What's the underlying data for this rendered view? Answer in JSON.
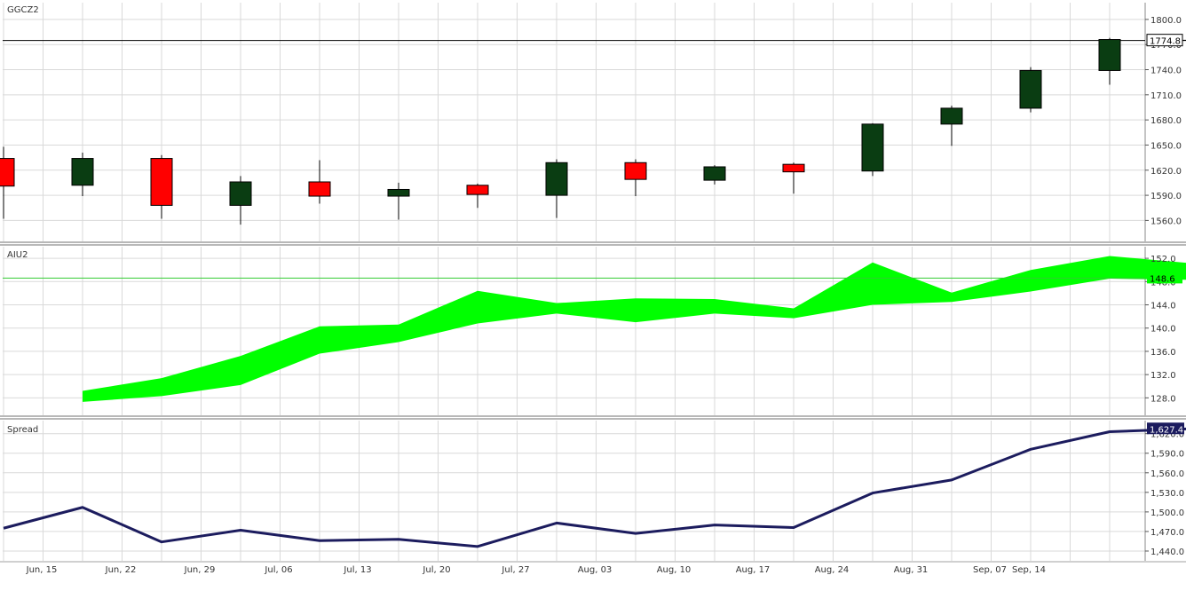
{
  "colors": {
    "background": "#ffffff",
    "grid": "#d9d9d9",
    "separator": "#a0a0a0",
    "candle_up": "#0a3d12",
    "candle_down": "#ff0000",
    "band_fill": "#00ff00",
    "band_ref_line": "#33cc33",
    "spread_line": "#1c1c5e",
    "last_price_line": "#000000",
    "label_text": "#333333"
  },
  "x_axis": {
    "labels": [
      "Jun, 15",
      "Jun, 22",
      "Jun, 29",
      "Jul, 06",
      "Jul, 13",
      "Jul, 20",
      "Jul, 27",
      "Aug, 03",
      "Aug, 10",
      "Aug, 17",
      "Aug, 24",
      "Aug, 31",
      "Sep, 07",
      "Sep, 14"
    ]
  },
  "chart_data": [
    {
      "type": "candlestick",
      "title": "GGCZ2",
      "ylim": [
        1535,
        1820
      ],
      "y_ticks": [
        "1800.0",
        "1770.0",
        "1740.0",
        "1710.0",
        "1680.0",
        "1650.0",
        "1620.0",
        "1590.0",
        "1560.0"
      ],
      "last_value_label": "1774.8",
      "last_value": 1774.8,
      "candles": [
        {
          "open": 1634,
          "high": 1648,
          "low": 1562,
          "close": 1601
        },
        {
          "open": 1602,
          "high": 1641,
          "low": 1589,
          "close": 1634
        },
        {
          "open": 1634,
          "high": 1638,
          "low": 1562,
          "close": 1578
        },
        {
          "open": 1578,
          "high": 1613,
          "low": 1555,
          "close": 1606
        },
        {
          "open": 1606,
          "high": 1632,
          "low": 1580,
          "close": 1589
        },
        {
          "open": 1589,
          "high": 1605,
          "low": 1561,
          "close": 1597
        },
        {
          "open": 1602,
          "high": 1604,
          "low": 1575,
          "close": 1591
        },
        {
          "open": 1590,
          "high": 1633,
          "low": 1563,
          "close": 1629
        },
        {
          "open": 1629,
          "high": 1633,
          "low": 1589,
          "close": 1609
        },
        {
          "open": 1608,
          "high": 1626,
          "low": 1603,
          "close": 1624
        },
        {
          "open": 1627,
          "high": 1629,
          "low": 1592,
          "close": 1618
        },
        {
          "open": 1619,
          "high": 1676,
          "low": 1613,
          "close": 1675
        },
        {
          "open": 1675,
          "high": 1697,
          "low": 1649,
          "close": 1694
        },
        {
          "open": 1694,
          "high": 1743,
          "low": 1689,
          "close": 1739
        },
        {
          "open": 1739,
          "high": 1778,
          "low": 1722,
          "close": 1776
        },
        {
          "open": 1775,
          "high": 1789,
          "low": 1755,
          "close": 1775
        }
      ]
    },
    {
      "type": "area",
      "title": "AIU2",
      "ylim": [
        125,
        154
      ],
      "y_ticks": [
        "152.0",
        "148.0",
        "144.0",
        "140.0",
        "136.0",
        "132.0",
        "128.0"
      ],
      "last_value_label": "148.6",
      "last_value": 148.6,
      "upper": [
        129.2,
        131.4,
        135.2,
        140.3,
        140.6,
        146.4,
        144.3,
        145.1,
        145.0,
        143.4,
        151.3,
        146.1,
        150.0,
        152.4,
        151.2
      ],
      "lower": [
        127.3,
        128.3,
        130.2,
        135.6,
        137.6,
        140.8,
        142.5,
        141.0,
        142.5,
        141.7,
        144.0,
        144.5,
        146.3,
        148.5,
        148.3
      ]
    },
    {
      "type": "line",
      "title": "Spread",
      "ylim": [
        1425,
        1640
      ],
      "y_ticks": [
        "1,620.0",
        "1,590.0",
        "1,560.0",
        "1,530.0",
        "1,500.0",
        "1,470.0",
        "1,440.0"
      ],
      "last_value_label": "1,627.4",
      "last_value": 1627.4,
      "values": [
        1475,
        1507,
        1454,
        1472,
        1456,
        1458,
        1447,
        1483,
        1467,
        1480,
        1476,
        1529,
        1549,
        1596,
        1623,
        1627.4
      ]
    }
  ]
}
